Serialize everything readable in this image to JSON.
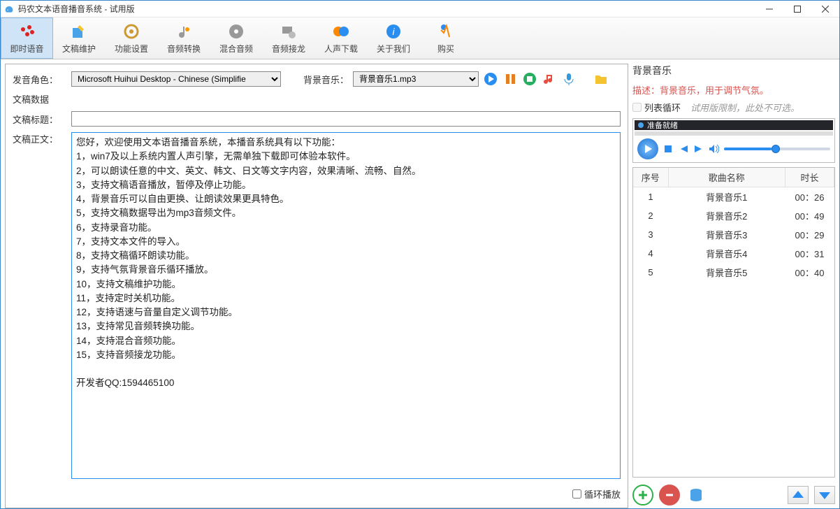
{
  "window": {
    "title": "码农文本语音播音系统 - 试用版"
  },
  "toolbar": {
    "items": [
      {
        "label": "即时语音"
      },
      {
        "label": "文稿维护"
      },
      {
        "label": "功能设置"
      },
      {
        "label": "音频转换"
      },
      {
        "label": "混合音频"
      },
      {
        "label": "音频接龙"
      },
      {
        "label": "人声下载"
      },
      {
        "label": "关于我们"
      },
      {
        "label": "购买"
      }
    ]
  },
  "voice": {
    "label": "发音角色：",
    "value": "Microsoft Huihui Desktop - Chinese (Simplifie"
  },
  "bgm": {
    "label": "背景音乐：",
    "value": "背景音乐1.mp3"
  },
  "section": {
    "data_label": "文稿数据"
  },
  "titlefield": {
    "label": "文稿标题：",
    "value": ""
  },
  "bodyfield": {
    "label": "文稿正文：",
    "value": "您好，欢迎使用文本语音播音系统，本播音系统具有以下功能：\n1，win7及以上系统内置人声引擎，无需单独下载即可体验本软件。\n2，可以朗读任意的中文、英文、韩文、日文等文字内容，效果清晰、流畅、自然。\n3，支持文稿语音播放，暂停及停止功能。\n4，背景音乐可以自由更换、让朗读效果更具特色。\n5，支持文稿数据导出为mp3音频文件。\n6，支持录音功能。\n7，支持文本文件的导入。\n8，支持文稿循环朗读功能。\n9，支持气氛背景音乐循环播放。\n10，支持文稿维护功能。\n11，支持定时关机功能。\n12，支持语速与音量自定义调节功能。\n13，支持常见音频转换功能。\n14，支持混合音频功能。\n15，支持音频接龙功能。\n\n开发者QQ:1594465100"
  },
  "loop": {
    "label": "循环播放"
  },
  "right": {
    "title": "背景音乐",
    "desc": "描述：背景音乐，用于调节气氛。",
    "loop_label": "列表循环",
    "hint": "试用版限制，此处不可选。"
  },
  "player": {
    "status": "准备就绪"
  },
  "playlist": {
    "headers": {
      "no": "序号",
      "name": "歌曲名称",
      "dur": "时长"
    },
    "rows": [
      {
        "no": "1",
        "name": "背景音乐1",
        "dur": "00：26"
      },
      {
        "no": "2",
        "name": "背景音乐2",
        "dur": "00：49"
      },
      {
        "no": "3",
        "name": "背景音乐3",
        "dur": "00：29"
      },
      {
        "no": "4",
        "name": "背景音乐4",
        "dur": "00：31"
      },
      {
        "no": "5",
        "name": "背景音乐5",
        "dur": "00：40"
      }
    ]
  }
}
